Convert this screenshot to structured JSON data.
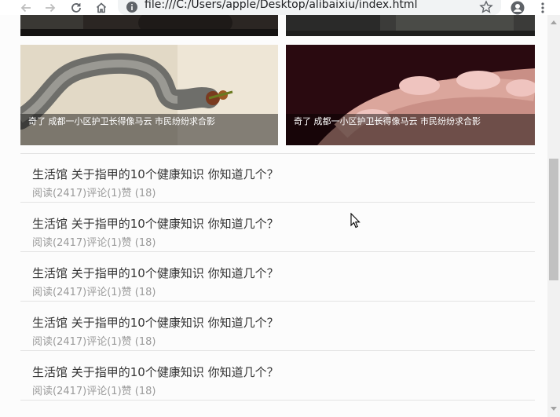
{
  "browser": {
    "url": "file:///C:/Users/apple/Desktop/alibaixiu/index.html",
    "icons": [
      "back-icon",
      "forward-icon",
      "reload-icon",
      "home-icon",
      "info-icon",
      "star-icon",
      "account-icon",
      "menu-icon"
    ]
  },
  "grid": {
    "tiles": [
      {
        "caption": ""
      },
      {
        "caption": ""
      },
      {
        "caption": "奇了 成都一小区护卫长得像马云 市民纷纷求合影"
      },
      {
        "caption": "奇了 成都一小区护卫长得像马云 市民纷纷求合影"
      }
    ]
  },
  "news": {
    "items": [
      {
        "title": "生活馆 关于指甲的10个健康知识 你知道几个？",
        "meta": "阅读(2417)评论(1)赞 (18)"
      },
      {
        "title": "生活馆 关于指甲的10个健康知识 你知道几个？",
        "meta": "阅读(2417)评论(1)赞 (18)"
      },
      {
        "title": "生活馆 关于指甲的10个健康知识 你知道几个？",
        "meta": "阅读(2417)评论(1)赞 (18)"
      },
      {
        "title": "生活馆 关于指甲的10个健康知识 你知道几个？",
        "meta": "阅读(2417)评论(1)赞 (18)"
      },
      {
        "title": "生活馆 关于指甲的10个健康知识 你知道几个？",
        "meta": "阅读(2417)评论(1)赞 (18)"
      }
    ]
  },
  "colors": {
    "page_bg": "#fcfcfc",
    "title_text": "#333333",
    "meta_text": "#9a9a9a",
    "divider": "#e3e3e3"
  }
}
